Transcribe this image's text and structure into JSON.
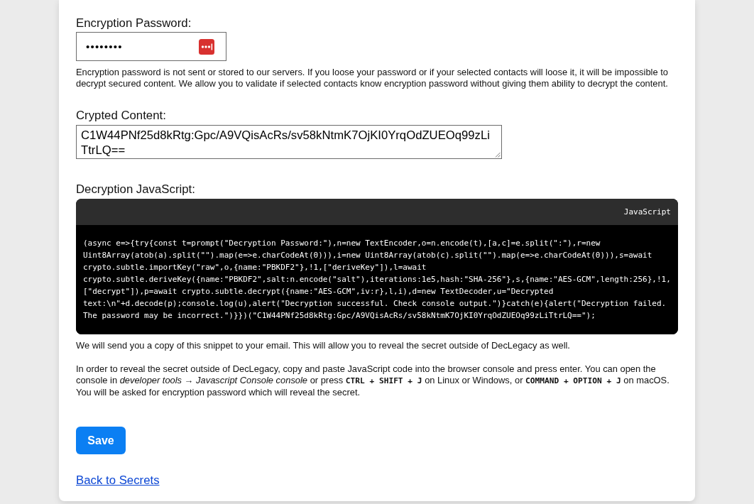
{
  "password": {
    "label": "Encryption Password:",
    "value": "••••••••",
    "note": "Encryption password is not sent or stored to our servers. If you loose your password or if your selected contacts will loose it, it will be impossible to decrypt secured content. We allow you to validate if selected contacts know encryption password without giving them ability to decrypt the content."
  },
  "crypted_content": {
    "label": "Crypted Content:",
    "value": "C1W44PNf25d8kRtg:Gpc/A9VQisAcRs/sv58kNtmK7OjKI0YrqOdZUEOq99zLiTtrLQ=="
  },
  "decryption_script": {
    "label": "Decryption JavaScript:",
    "language": "JavaScript",
    "code": "(async e=>{try{const t=prompt(\"Decryption Password:\"),n=new TextEncoder,o=n.encode(t),[a,c]=e.split(\":\"),r=new Uint8Array(atob(a).split(\"\").map(e=>e.charCodeAt(0))),i=new Uint8Array(atob(c).split(\"\").map(e=>e.charCodeAt(0))),s=await crypto.subtle.importKey(\"raw\",o,{name:\"PBKDF2\"},!1,[\"deriveKey\"]),l=await crypto.subtle.deriveKey({name:\"PBKDF2\",salt:n.encode(\"salt\"),iterations:1e5,hash:\"SHA-256\"},s,{name:\"AES-GCM\",length:256},!1,[\"decrypt\"]),p=await crypto.subtle.decrypt({name:\"AES-GCM\",iv:r},l,i),d=new TextDecoder,u=\"Decrypted text:\\n\"+d.decode(p);console.log(u),alert(\"Decryption successful. Check console output.\")}catch(e){alert(\"Decryption failed. The password may be incorrect.\")}})(\"C1W44PNf25d8kRtg:Gpc/A9VQisAcRs/sv58kNtmK7OjKI0YrqOdZUEOq99zLiTtrLQ==\");"
  },
  "notes": [
    "We will send you a copy of this snippet to your email. This will allow you to reveal the secret outside of DecLegacy as well.",
    "In order to reveal the secret outside of DecLegacy, copy and paste JavaScript code into the browser console and press enter. You can open the console in *developer tools → Javascript Console console* or press **CTRL + SHIFT + J** on Linux or Windows, or **COMMAND + OPTION + J** on macOS. You will be asked for encryption password which will reveal the secret."
  ],
  "save_button": "Save",
  "back_link": "Back to Secrets"
}
